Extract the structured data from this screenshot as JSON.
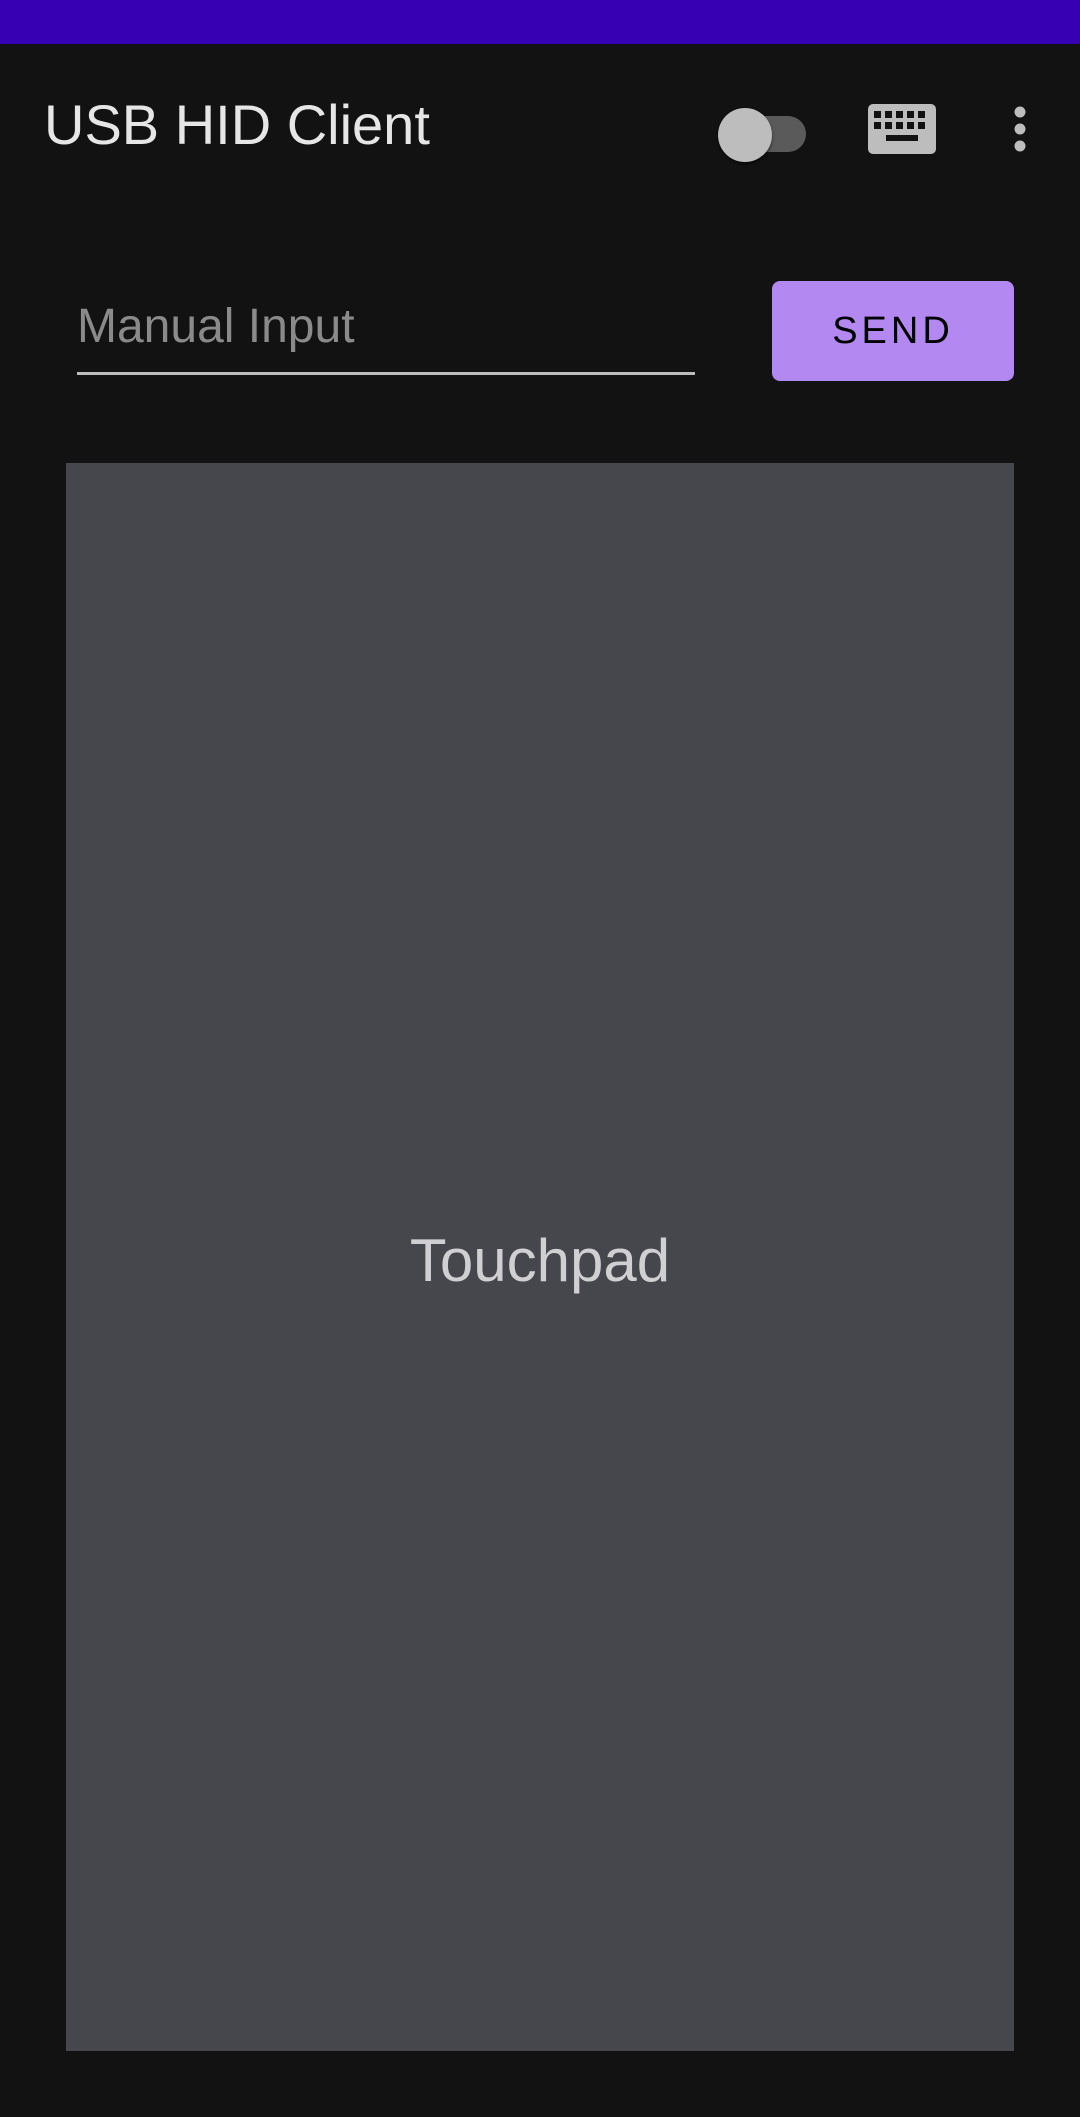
{
  "app": {
    "title": "USB HID Client"
  },
  "status_bar": {
    "color": "#3700b3"
  },
  "toolbar": {
    "toggle": {
      "state": "off",
      "name": "toggle-switch"
    },
    "keyboard_icon": "keyboard-icon",
    "more_icon": "more-vert-icon"
  },
  "input": {
    "placeholder": "Manual Input",
    "value": ""
  },
  "send_button": {
    "label": "SEND",
    "color": "#b388f0"
  },
  "touchpad": {
    "label": "Touchpad",
    "color": "#46474d"
  }
}
